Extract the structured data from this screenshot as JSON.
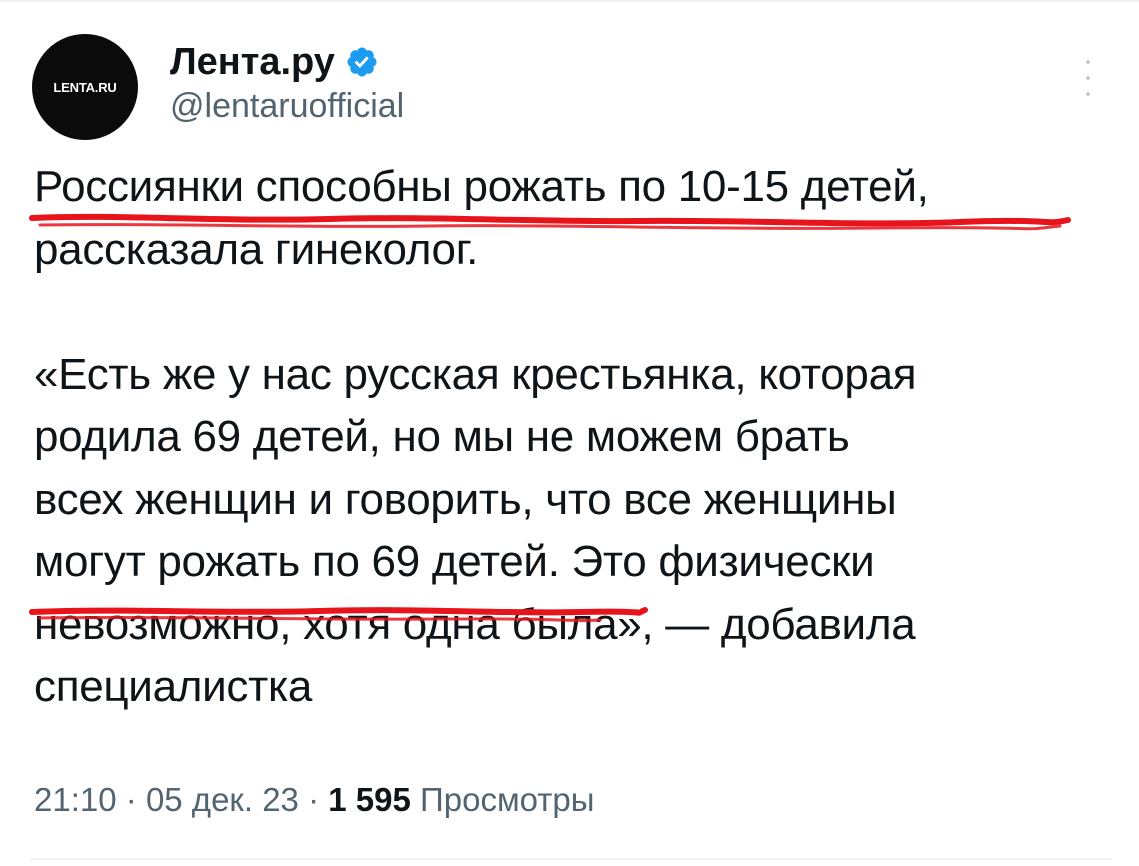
{
  "author": {
    "display_name": "Лента.ру",
    "handle": "@lentaruofficial",
    "avatar_text": "LENTA.RU"
  },
  "tweet": {
    "line1": "Россиянки способны рожать по 10-15 детей,",
    "line2": "рассказала гинеколог.",
    "line3": "«Есть же у нас русская крестьянка, которая",
    "line4": "родила 69 детей, но мы не можем брать",
    "line5": "всех женщин и говорить, что все женщины",
    "line6": "могут рожать по 69 детей. Это физически",
    "line7": "невозможно, хотя одна была», — добавила",
    "line8": "специалистка"
  },
  "meta": {
    "time": "21:10",
    "date": "05 дек. 23",
    "separator": "·",
    "views_count": "1 595",
    "views_label": "Просмотры"
  },
  "colors": {
    "verified": "#1d9bf0",
    "annotation": "#e8141b",
    "secondary_text": "#536471"
  },
  "icons": {
    "verified": "verified-badge-icon",
    "more": "more-vertical-icon"
  }
}
